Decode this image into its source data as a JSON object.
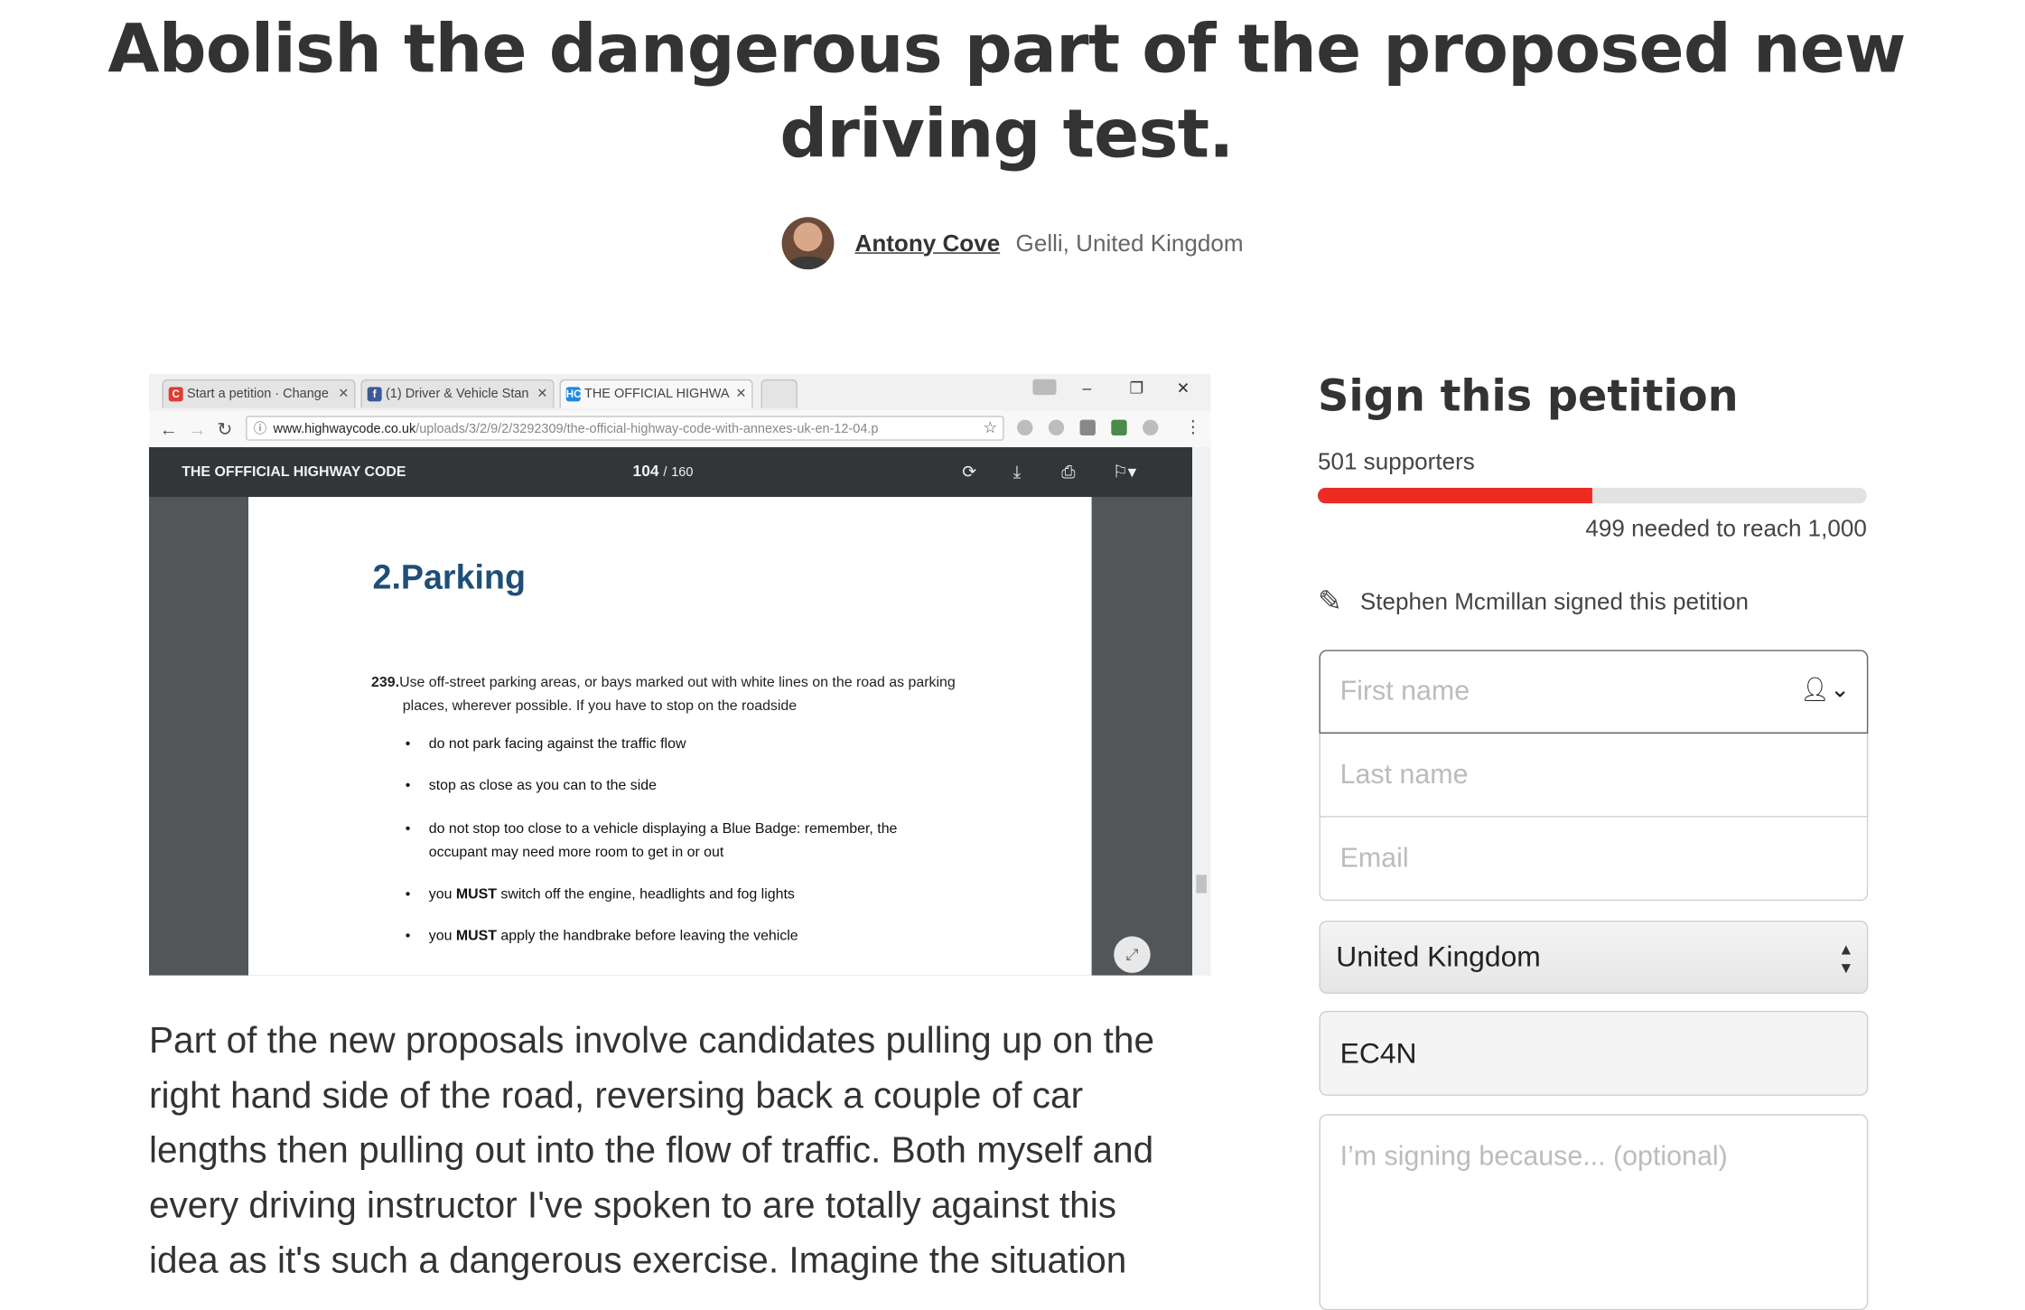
{
  "petition": {
    "title": "Abolish the dangerous part of the proposed new driving test.",
    "author_name": "Antony Cove",
    "author_location": "Gelli, United Kingdom",
    "body": "Part of the new proposals involve candidates pulling up on the right hand side of the road, reversing back a couple of car lengths then pulling out into the flow of traffic. Both myself and every driving instructor I've spoken to are totally against this idea as it's such a dangerous exercise. Imagine the situation"
  },
  "screenshot": {
    "tabs": [
      {
        "label": "Start a petition · Change",
        "icon": "change-favicon",
        "color": "#e03c31"
      },
      {
        "label": "(1) Driver & Vehicle Stan",
        "icon": "facebook-favicon",
        "color": "#3b5998"
      },
      {
        "label": "THE OFFICIAL HIGHWA",
        "icon": "hc-favicon",
        "color": "#1e88e5"
      }
    ],
    "url_domain": "www.highwaycode.co.uk",
    "url_path": "/uploads/3/2/9/2/3292309/the-official-highway-code-with-annexes-uk-en-12-04.p",
    "pdf_title": "THE OFFFICIAL HIGHWAY CODE",
    "pdf_page": "104",
    "pdf_sep": "/",
    "pdf_total": "160",
    "doc_heading": "2.Parking",
    "rule_number": "239.",
    "rule_text_1": "Use off-street parking areas, or bays marked out with white lines on the road as parking",
    "rule_text_2": "places, wherever possible. If you have to stop on the roadside",
    "bullets": [
      {
        "pre": "do not park facing against the traffic flow",
        "bold": "",
        "post": ""
      },
      {
        "pre": "stop as close as you can to the side",
        "bold": "",
        "post": ""
      },
      {
        "pre": "do not stop too close to a vehicle displaying a Blue Badge: remember, the",
        "bold": "",
        "post": ""
      },
      {
        "pre": "occupant may need more room to get in or out",
        "bold": "",
        "post": ""
      },
      {
        "pre": "you ",
        "bold": "MUST",
        "post": " switch off the engine, headlights and fog lights"
      },
      {
        "pre": "you ",
        "bold": "MUST",
        "post": " apply the handbrake before leaving the vehicle"
      }
    ]
  },
  "sign": {
    "title": "Sign this petition",
    "supporters": "501 supporters",
    "progress_fraction": 0.501,
    "needed": "499 needed to reach 1,000",
    "recent_signer": "Stephen Mcmillan signed this petition",
    "first_name_placeholder": "First name",
    "last_name_placeholder": "Last name",
    "email_placeholder": "Email",
    "country": "United Kingdom",
    "postcode": "EC4N",
    "reason_placeholder": "I’m signing because... (optional)"
  },
  "colors": {
    "progress": "#ec2c22",
    "pdf_toolbar": "#323639",
    "doc_heading": "#1f4e79"
  }
}
